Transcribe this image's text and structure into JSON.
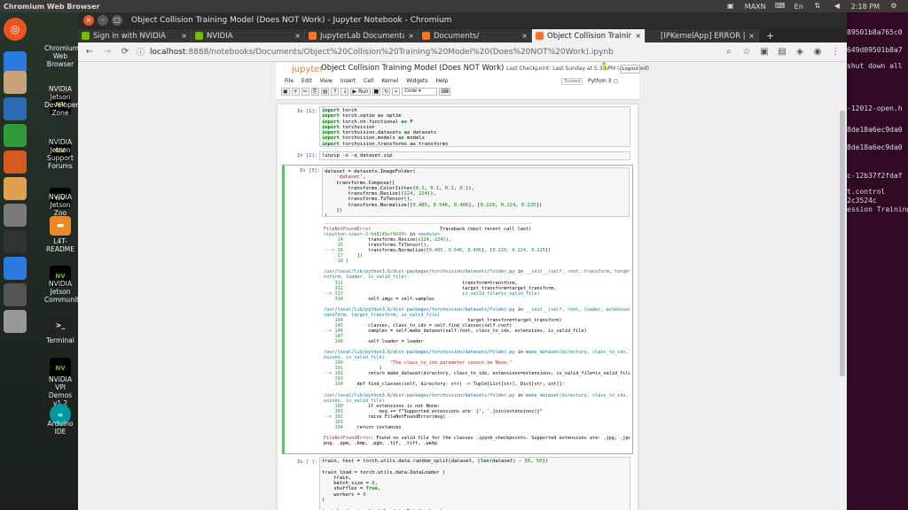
{
  "os": {
    "app_title": "Chromium Web Browser",
    "indicators": {
      "power_mode": "MAXN",
      "lang": "En",
      "time": "2:18 PM"
    }
  },
  "launcher": [
    {
      "label": "Chromium Web Browser",
      "icon": "chromium-icon",
      "color": "#2a7ae2"
    },
    {
      "label": "",
      "icon": "files-icon",
      "color": "#c8a37a"
    },
    {
      "label": "",
      "icon": "writer-icon",
      "color": "#2b6cb8"
    },
    {
      "label": "",
      "icon": "calc-icon",
      "color": "#2e9a3a"
    },
    {
      "label": "",
      "icon": "impress-icon",
      "color": "#d45a1f"
    },
    {
      "label": "",
      "icon": "software-icon",
      "color": "#e0a050"
    },
    {
      "label": "",
      "icon": "settings-icon",
      "color": "#7a7a7a"
    },
    {
      "label": "",
      "icon": "terminal-icon",
      "color": "#333333"
    },
    {
      "label": "",
      "icon": "chromium-icon",
      "color": "#2a7ae2"
    },
    {
      "label": "",
      "icon": "updater-icon",
      "color": "#555555"
    },
    {
      "label": "",
      "icon": "drive-icon",
      "color": "#999999"
    }
  ],
  "desktop": [
    {
      "label": "NVIDIA Jetson Developer Zone"
    },
    {
      "label": "NVIDIA Jetson Support Forums"
    },
    {
      "label": "NVIDIA Jetson Zoo"
    },
    {
      "label": "L4T-README"
    },
    {
      "label": "NVIDIA Jetson Community"
    },
    {
      "label": "Terminal"
    },
    {
      "label": "NVIDIA VPI Demos v1.2"
    },
    {
      "label": "Arduino IDE"
    }
  ],
  "terminal_lines": [
    "89501b8a765c0",
    "649d09501b8a7",
    "shut down all",
    "-12012-open.h",
    "8de18a6ec9da0",
    "8de18a6ec9da0",
    "c-12b37f2fdaf",
    "t.control",
    "2c3524c",
    "ession Training"
  ],
  "window": {
    "title": "Object Collision Training Model (Does NOT Work) - Jupyter Notebook - Chromium",
    "tabs": [
      {
        "label": "Sign in with NVIDIA",
        "fav": "#76b900",
        "active": false
      },
      {
        "label": "NVIDIA",
        "fav": "#76b900",
        "active": false
      },
      {
        "label": "JupyterLab Documentati",
        "fav": "#f37726",
        "active": false
      },
      {
        "label": "Documents/",
        "fav": "#f37726",
        "active": false
      },
      {
        "label": "Object Collision Training",
        "fav": "#f37726",
        "active": true
      },
      {
        "label": "[IPKernelApp] ERROR | No",
        "fav": "#333333",
        "active": false
      }
    ],
    "url_host": "localhost",
    "url_path": ":8888/notebooks/Documents/Object%20Collision%20Training%20Model%20(Does%20NOT%20Work).ipynb"
  },
  "jupyter": {
    "logo": "jupyter",
    "notebook_title": "Object Collision Training Model (Does NOT Work)",
    "checkpoint": "Last Checkpoint: Last Sunday at 5:38 PM  (autosaved)",
    "logout": "Logout",
    "menu": [
      "File",
      "Edit",
      "View",
      "Insert",
      "Cell",
      "Kernel",
      "Widgets",
      "Help"
    ],
    "trusted": "Trusted",
    "kernel": "Python 3",
    "run_label": "Run",
    "celltype": "Code"
  },
  "cells": {
    "c1": {
      "prompt": "In [1]:"
    },
    "c2": {
      "prompt": "In [2]:",
      "code": "!unzip -o -q dataset.zip"
    },
    "c3": {
      "prompt": "In [3]:"
    },
    "c4": {
      "prompt": "In [ ]:"
    }
  }
}
